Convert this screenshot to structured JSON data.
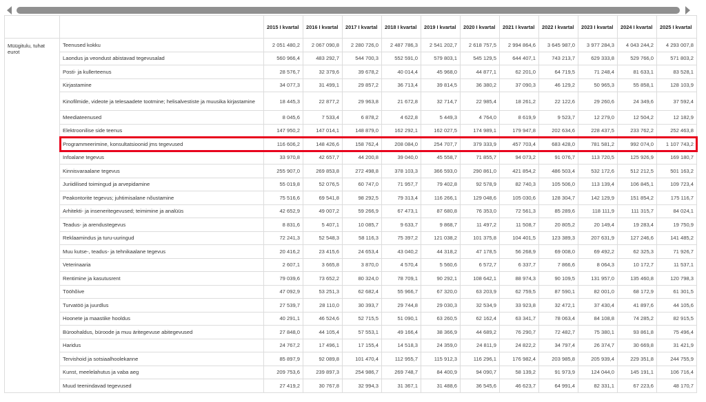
{
  "colors": {
    "highlight": "#e8001c",
    "scroll_thumb": "#909090"
  },
  "icons": {
    "scroll_left": "triangle-left-icon",
    "scroll_right": "triangle-right-icon"
  },
  "table": {
    "dimension_label": "Müügitulu, tuhat eurot",
    "columns": [
      "2015 I kvartal",
      "2016 I kvartal",
      "2017 I kvartal",
      "2018 I kvartal",
      "2019 I kvartal",
      "2020 I kvartal",
      "2021 I kvartal",
      "2022 I kvartal",
      "2023 I kvartal",
      "2024 I kvartal",
      "2025 I kvartal"
    ],
    "highlighted_row": 7,
    "rows": [
      {
        "label": "Teenused kokku",
        "values": [
          "2 051 480,2",
          "2 067 090,8",
          "2 280 726,0",
          "2 487 786,3",
          "2 541 202,7",
          "2 618 757,5",
          "2 994 864,6",
          "3 645 987,0",
          "3 977 284,3",
          "4 043 244,2",
          "4 293 007,8"
        ]
      },
      {
        "label": "Laondus ja veondust abistavad tegevusalad",
        "values": [
          "560 966,4",
          "483 292,7",
          "544 700,3",
          "552 591,0",
          "579 803,1",
          "545 129,5",
          "644 407,1",
          "743 213,7",
          "629 333,8",
          "529 766,0",
          "571 803,2"
        ]
      },
      {
        "label": "Posti- ja kullerteenus",
        "values": [
          "28 576,7",
          "32 379,6",
          "39 678,2",
          "40 014,4",
          "45 968,0",
          "44 877,1",
          "62 201,0",
          "64 719,5",
          "71 248,4",
          "81 633,1",
          "83 528,1"
        ]
      },
      {
        "label": "Kirjastamine",
        "values": [
          "34 077,3",
          "31 499,1",
          "29 857,2",
          "36 713,4",
          "39 814,5",
          "36 380,2",
          "37 090,3",
          "46 129,2",
          "50 965,3",
          "55 858,1",
          "128 103,9"
        ]
      },
      {
        "label": "Kinofilmide, videote ja telesaadete tootmine; helisalvestiste ja muusika kirjastamine",
        "values": [
          "18 445,3",
          "22 877,2",
          "29 963,8",
          "21 672,8",
          "32 714,7",
          "22 985,4",
          "18 261,2",
          "22 122,6",
          "29 260,6",
          "24 349,6",
          "37 592,4"
        ]
      },
      {
        "label": "Meediateenused",
        "values": [
          "8 045,6",
          "7 533,4",
          "6 878,2",
          "4 622,8",
          "5 449,3",
          "4 764,0",
          "8 619,9",
          "9 523,7",
          "12 279,0",
          "12 504,2",
          "12 182,9"
        ]
      },
      {
        "label": "Elektroonilise side teenus",
        "values": [
          "147 950,2",
          "147 014,1",
          "148 879,0",
          "162 292,1",
          "162 027,5",
          "174 989,1",
          "179 947,8",
          "202 634,6",
          "228 437,5",
          "233 762,2",
          "252 463,8"
        ]
      },
      {
        "label": "Programmeerimine, konsultatsioonid jms tegevused",
        "values": [
          "116 606,2",
          "148 426,6",
          "158 762,4",
          "208 084,0",
          "254 707,7",
          "379 333,9",
          "457 703,4",
          "683 428,0",
          "781 581,2",
          "992 074,0",
          "1 107 743,2"
        ]
      },
      {
        "label": "Infoalane tegevus",
        "values": [
          "33 970,8",
          "42 657,7",
          "44 200,8",
          "39 040,0",
          "45 558,7",
          "71 855,7",
          "94 073,2",
          "91 076,7",
          "113 720,5",
          "125 926,9",
          "169 180,7"
        ]
      },
      {
        "label": "Kinnisvaraalane tegevus",
        "values": [
          "255 907,0",
          "269 853,8",
          "272 498,8",
          "378 103,3",
          "366 593,0",
          "290 861,0",
          "421 854,2",
          "486 503,4",
          "532 172,6",
          "512 212,5",
          "501 163,2"
        ]
      },
      {
        "label": "Juriidilised toimingud ja arvepidamine",
        "values": [
          "55 019,8",
          "52 076,5",
          "60 747,0",
          "71 957,7",
          "79 402,8",
          "92 578,9",
          "82 740,3",
          "105 506,0",
          "113 139,4",
          "106 845,1",
          "109 723,4"
        ]
      },
      {
        "label": "Peakontorite tegevus; juhtimisalane nõustamine",
        "values": [
          "75 516,6",
          "69 541,8",
          "98 292,5",
          "79 313,4",
          "116 266,1",
          "129 048,6",
          "105 030,6",
          "128 304,7",
          "142 129,9",
          "151 854,2",
          "175 116,7"
        ]
      },
      {
        "label": "Arhitekti- ja inseneritegevused; teimimine ja analüüs",
        "values": [
          "42 652,9",
          "49 007,2",
          "59 266,9",
          "67 473,1",
          "87 680,8",
          "76 353,0",
          "72 561,3",
          "85 289,6",
          "118 111,9",
          "111 315,7",
          "84 024,1"
        ]
      },
      {
        "label": "Teadus- ja arendustegevus",
        "values": [
          "8 831,6",
          "5 407,1",
          "10 085,7",
          "9 633,7",
          "9 868,7",
          "11 497,2",
          "11 508,7",
          "20 805,2",
          "20 149,4",
          "19 283,4",
          "19 750,9"
        ]
      },
      {
        "label": "Reklaamindus ja turu-uuringud",
        "values": [
          "72 241,3",
          "52 548,3",
          "58 116,3",
          "75 397,2",
          "121 038,2",
          "101 375,8",
          "104 401,5",
          "123 389,3",
          "207 631,9",
          "127 246,6",
          "141 485,2"
        ]
      },
      {
        "label": "Muu kutse-, teadus- ja tehnikaalane tegevus",
        "values": [
          "20 416,2",
          "23 415,6",
          "24 653,4",
          "43 040,2",
          "44 318,2",
          "47 178,5",
          "56 268,9",
          "69 008,0",
          "69 492,2",
          "62 325,3",
          "71 926,7"
        ]
      },
      {
        "label": "Veterinaaria",
        "values": [
          "2 607,1",
          "3 665,8",
          "3 870,0",
          "4 570,4",
          "5 560,6",
          "6 572,7",
          "6 337,7",
          "7 866,6",
          "8 064,3",
          "10 172,7",
          "11 537,1"
        ]
      },
      {
        "label": "Rentimine ja kasutusrent",
        "values": [
          "79 039,6",
          "73 652,2",
          "80 324,0",
          "78 709,1",
          "90 292,1",
          "108 642,1",
          "88 974,3",
          "90 109,5",
          "131 957,0",
          "135 460,8",
          "120 798,3"
        ]
      },
      {
        "label": "Tööhõive",
        "values": [
          "47 092,9",
          "53 251,3",
          "62 682,4",
          "55 966,7",
          "67 320,0",
          "63 203,9",
          "62 759,5",
          "87 590,1",
          "82 001,0",
          "68 172,9",
          "61 301,5"
        ]
      },
      {
        "label": "Turvatöö ja juurdlus",
        "values": [
          "27 539,7",
          "28 110,0",
          "30 393,7",
          "29 744,8",
          "29 030,3",
          "32 534,9",
          "33 923,8",
          "32 472,1",
          "37 430,4",
          "41 897,6",
          "44 105,6"
        ]
      },
      {
        "label": "Hoonete ja maastike hooldus",
        "values": [
          "40 291,1",
          "46 524,6",
          "52 715,5",
          "51 090,1",
          "63 260,5",
          "62 162,4",
          "63 341,7",
          "78 063,4",
          "84 108,8",
          "74 285,2",
          "82 915,5"
        ]
      },
      {
        "label": "Büroohaldus, büroode ja muu äritegevuse abitegevused",
        "values": [
          "27 848,0",
          "44 105,4",
          "57 553,1",
          "49 166,4",
          "38 366,9",
          "44 689,2",
          "76 290,7",
          "72 482,7",
          "75 380,1",
          "93 861,8",
          "75 496,4"
        ]
      },
      {
        "label": "Haridus",
        "values": [
          "24 767,2",
          "17 496,1",
          "17 155,4",
          "14 518,3",
          "24 359,0",
          "24 811,9",
          "24 822,2",
          "34 797,4",
          "26 374,7",
          "30 669,8",
          "31 421,9"
        ]
      },
      {
        "label": "Tervishoid ja sotsiaalhoolekanne",
        "values": [
          "85 897,9",
          "92 089,8",
          "101 470,4",
          "112 955,7",
          "115 912,3",
          "116 296,1",
          "176 982,4",
          "203 985,8",
          "205 939,4",
          "229 351,8",
          "244 755,9"
        ]
      },
      {
        "label": "Kunst, meelelahutus ja vaba aeg",
        "values": [
          "209 753,6",
          "239 897,3",
          "254 986,7",
          "269 748,7",
          "84 400,9",
          "94 090,7",
          "58 139,2",
          "91 973,9",
          "124 044,0",
          "145 191,1",
          "106 716,4"
        ]
      },
      {
        "label": "Muud teenindavad tegevused",
        "values": [
          "27 419,2",
          "30 767,8",
          "32 994,3",
          "31 367,1",
          "31 488,6",
          "36 545,6",
          "46 623,7",
          "64 991,4",
          "82 331,1",
          "67 223,6",
          "48 170,7"
        ]
      }
    ]
  }
}
